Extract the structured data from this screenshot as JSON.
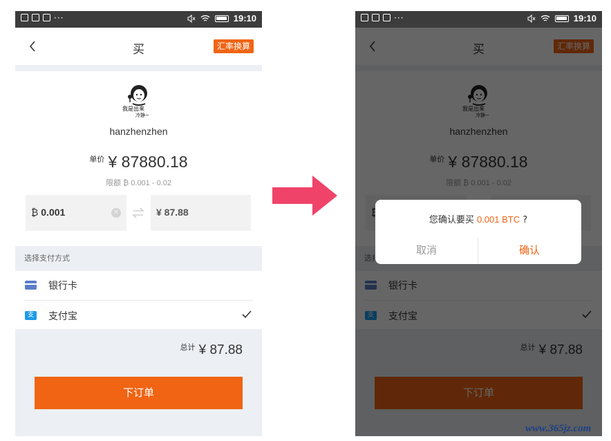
{
  "status_bar": {
    "time": "19:10",
    "dots": "···"
  },
  "nav": {
    "title": "买",
    "rate_button": "汇率换算"
  },
  "seller": {
    "username": "hanzhenzhen"
  },
  "price": {
    "label": "单价",
    "value": "¥ 87880.18",
    "limit": "限额 ₿ 0.001 - 0.02"
  },
  "inputs": {
    "btc_symbol": "₿",
    "btc_value": "0.001",
    "cny_value": "¥ 87.88"
  },
  "payment": {
    "section_title": "选择支付方式",
    "methods": [
      {
        "label": "银行卡",
        "icon": "bank-card-icon",
        "selected": false
      },
      {
        "label": "支付宝",
        "icon": "alipay-icon",
        "selected": true
      }
    ]
  },
  "total": {
    "label": "总计",
    "value": "¥ 87.88"
  },
  "order_button": "下订单",
  "dialog": {
    "prefix": "您确认要买",
    "amount": "0.001 BTC",
    "suffix": "?",
    "cancel": "取消",
    "confirm": "确认"
  },
  "colors": {
    "accent": "#f06414",
    "status_bar": "#3c3c3c",
    "gray_bg": "#eceff3",
    "arrow": "#f0436a"
  },
  "watermark": "www.365jz.com"
}
